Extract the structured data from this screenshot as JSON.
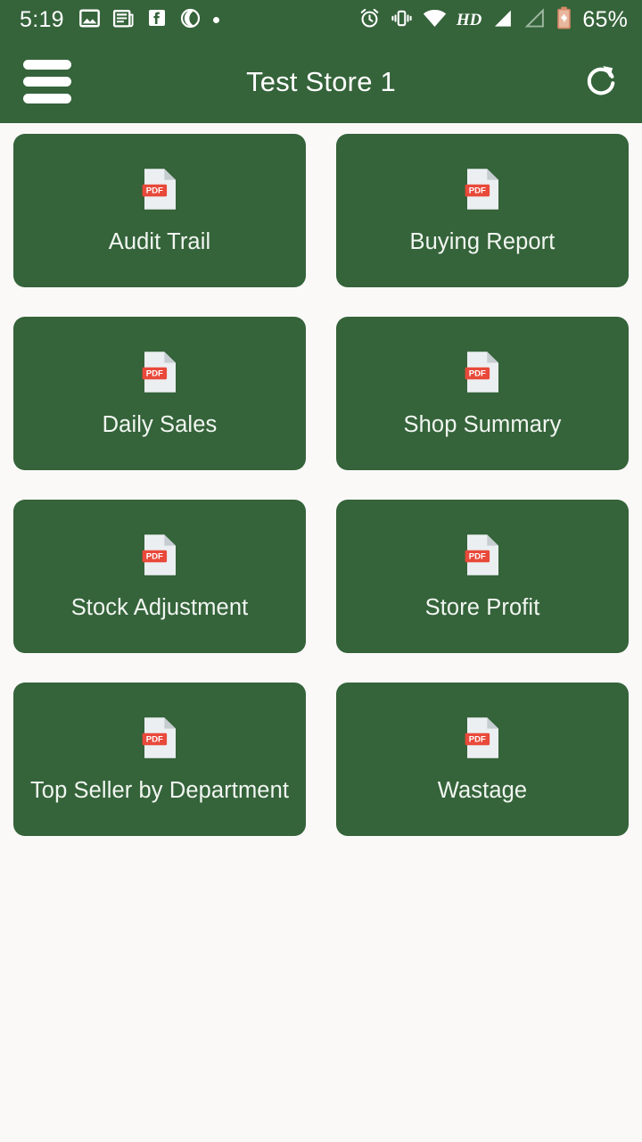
{
  "status_bar": {
    "time": "5:19",
    "battery_percent": "65%",
    "hd_label": "HD",
    "left_icons": [
      "photo-icon",
      "news-icon",
      "facebook-icon",
      "vodafone-icon",
      "dot-icon"
    ],
    "right_icons": [
      "alarm-icon",
      "vibrate-icon",
      "wifi-icon",
      "hd-label",
      "signal-bars-icon",
      "signal-bars-empty-icon",
      "battery-charging-icon"
    ],
    "background_color": "#35633a",
    "foreground_color": "#ffffff"
  },
  "app_bar": {
    "title": "Test Store 1",
    "menu_icon": "hamburger-menu-icon",
    "refresh_icon": "refresh-icon",
    "background_color": "#35633a",
    "title_color": "#ffffff"
  },
  "theme": {
    "page_background": "#faf9f8",
    "card_background": "#35633a",
    "card_text": "#f1f6f1",
    "pdf_badge_red": "#e8493a",
    "pdf_paper": "#eceff1"
  },
  "report_grid": {
    "icon_name": "pdf-file-icon",
    "icon_badge_text": "PDF",
    "cards": [
      {
        "label": "Audit Trail"
      },
      {
        "label": "Buying Report"
      },
      {
        "label": "Daily Sales"
      },
      {
        "label": "Shop Summary"
      },
      {
        "label": "Stock Adjustment"
      },
      {
        "label": "Store Profit"
      },
      {
        "label": "Top Seller by Department"
      },
      {
        "label": "Wastage"
      }
    ]
  }
}
